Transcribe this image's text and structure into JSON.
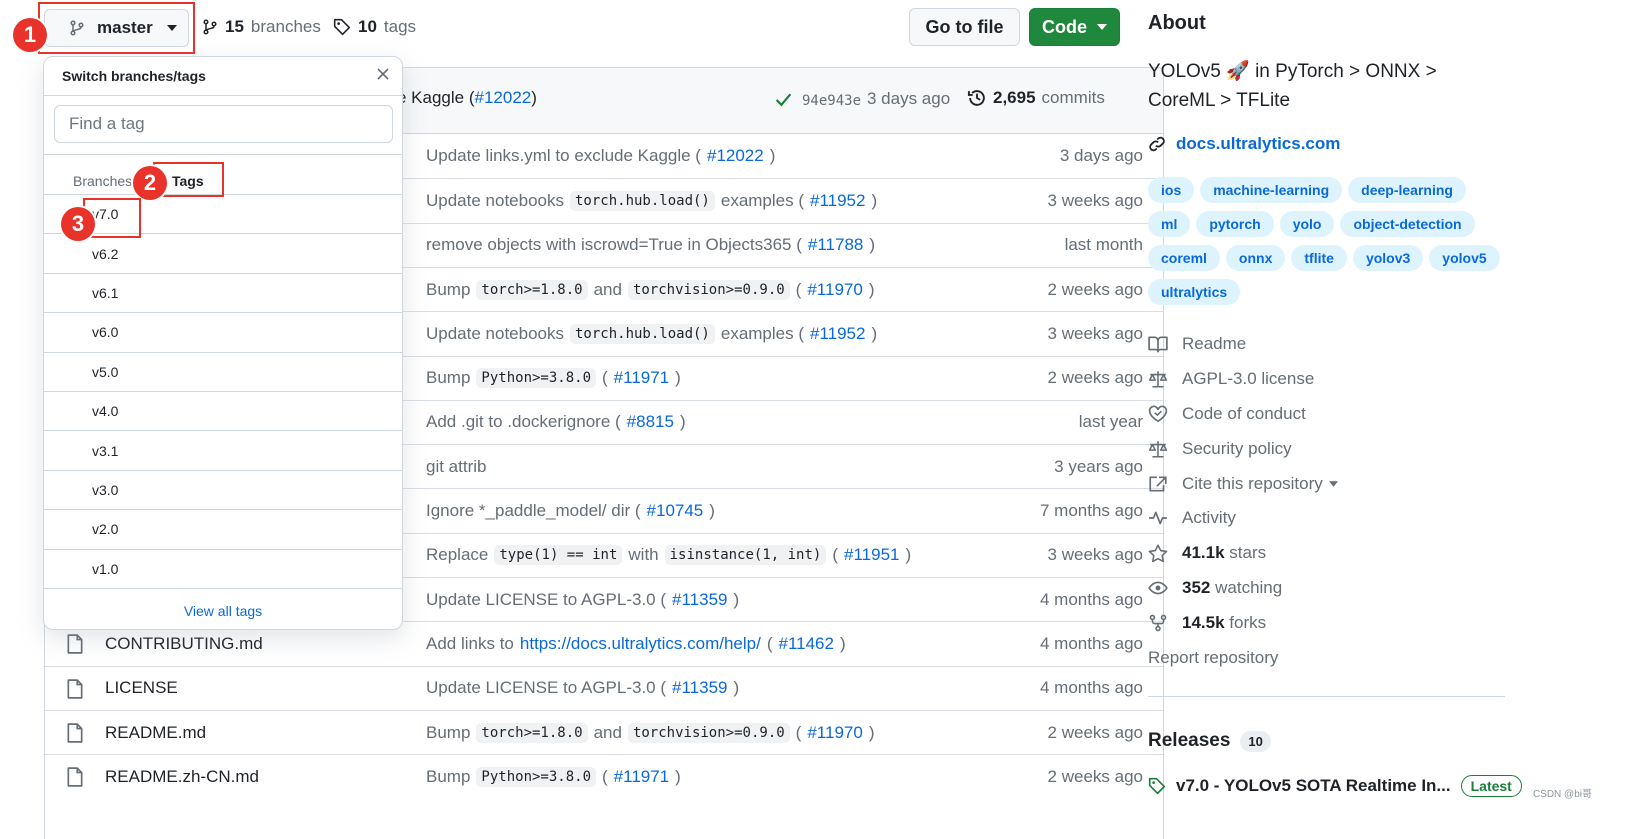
{
  "topbar": {
    "branch": "master",
    "branches_count": "15",
    "branches_label": "branches",
    "tags_count": "10",
    "tags_label": "tags",
    "go_to_file": "Go to file",
    "code": "Code"
  },
  "annotations": {
    "one": "1",
    "two": "2",
    "three": "3"
  },
  "commit_head": {
    "message_prefix": "e Kaggle (",
    "pr": "#12022",
    "message_suffix": ")",
    "sha": "94e943e",
    "time": "3 days ago",
    "commits_count": "2,695",
    "commits_label": "commits"
  },
  "rows": [
    {
      "name": "",
      "time": "3 days ago",
      "parts": [
        {
          "t": "Update links.yml to exclude Kaggle ("
        },
        {
          "l": "#12022"
        },
        {
          "t": ")"
        }
      ]
    },
    {
      "name": "",
      "time": "3 weeks ago",
      "parts": [
        {
          "t": "Update notebooks "
        },
        {
          "c": "torch.hub.load()"
        },
        {
          "t": " examples ("
        },
        {
          "l": "#11952"
        },
        {
          "t": ")"
        }
      ]
    },
    {
      "name": "",
      "time": "last month",
      "parts": [
        {
          "t": "remove objects with iscrowd=True in Objects365 ("
        },
        {
          "l": "#11788"
        },
        {
          "t": ")"
        }
      ]
    },
    {
      "name": "",
      "time": "2 weeks ago",
      "parts": [
        {
          "t": "Bump "
        },
        {
          "c": "torch>=1.8.0"
        },
        {
          "t": " and "
        },
        {
          "c": "torchvision>=0.9.0"
        },
        {
          "t": " ("
        },
        {
          "l": "#11970"
        },
        {
          "t": ")"
        }
      ]
    },
    {
      "name": "",
      "time": "3 weeks ago",
      "parts": [
        {
          "t": "Update notebooks "
        },
        {
          "c": "torch.hub.load()"
        },
        {
          "t": " examples ("
        },
        {
          "l": "#11952"
        },
        {
          "t": ")"
        }
      ]
    },
    {
      "name": "",
      "time": "2 weeks ago",
      "parts": [
        {
          "t": "Bump "
        },
        {
          "c": "Python>=3.8.0"
        },
        {
          "t": " ("
        },
        {
          "l": "#11971"
        },
        {
          "t": ")"
        }
      ]
    },
    {
      "name": "",
      "time": "last year",
      "parts": [
        {
          "t": "Add .git to .dockerignore ("
        },
        {
          "l": "#8815"
        },
        {
          "t": ")"
        }
      ]
    },
    {
      "name": "",
      "time": "3 years ago",
      "parts": [
        {
          "t": "git attrib"
        }
      ]
    },
    {
      "name": "",
      "time": "7 months ago",
      "parts": [
        {
          "t": "Ignore *_paddle_model/ dir ("
        },
        {
          "l": "#10745"
        },
        {
          "t": ")"
        }
      ]
    },
    {
      "name": "",
      "time": "3 weeks ago",
      "parts": [
        {
          "t": "Replace "
        },
        {
          "c": "type(1) == int"
        },
        {
          "t": " with "
        },
        {
          "c": "isinstance(1, int)"
        },
        {
          "t": " ("
        },
        {
          "l": "#11951"
        },
        {
          "t": ")"
        }
      ]
    },
    {
      "name": "",
      "time": "4 months ago",
      "parts": [
        {
          "t": "Update LICENSE to AGPL-3.0 ("
        },
        {
          "l": "#11359"
        },
        {
          "t": ")"
        }
      ]
    },
    {
      "name": "CONTRIBUTING.md",
      "time": "4 months ago",
      "parts": [
        {
          "t": "Add links to "
        },
        {
          "l": "https://docs.ultralytics.com/help/"
        },
        {
          "t": " ("
        },
        {
          "l": "#11462"
        },
        {
          "t": ")"
        }
      ]
    },
    {
      "name": "LICENSE",
      "time": "4 months ago",
      "parts": [
        {
          "t": "Update LICENSE to AGPL-3.0 ("
        },
        {
          "l": "#11359"
        },
        {
          "t": ")"
        }
      ]
    },
    {
      "name": "README.md",
      "time": "2 weeks ago",
      "parts": [
        {
          "t": "Bump "
        },
        {
          "c": "torch>=1.8.0"
        },
        {
          "t": " and "
        },
        {
          "c": "torchvision>=0.9.0"
        },
        {
          "t": " ("
        },
        {
          "l": "#11970"
        },
        {
          "t": ")"
        }
      ]
    },
    {
      "name": "README.zh-CN.md",
      "time": "2 weeks ago",
      "parts": [
        {
          "t": "Bump "
        },
        {
          "c": "Python>=3.8.0"
        },
        {
          "t": " ("
        },
        {
          "l": "#11971"
        },
        {
          "t": ")"
        }
      ]
    }
  ],
  "dropdown": {
    "title": "Switch branches/tags",
    "placeholder": "Find a tag",
    "tab_branches": "Branches",
    "tab_tags": "Tags",
    "tags": [
      "v7.0",
      "v6.2",
      "v6.1",
      "v6.0",
      "v5.0",
      "v4.0",
      "v3.1",
      "v3.0",
      "v2.0",
      "v1.0"
    ],
    "view_all": "View all tags"
  },
  "about": {
    "title": "About",
    "description": "YOLOv5 🚀 in PyTorch > ONNX > CoreML > TFLite",
    "homepage": "docs.ultralytics.com",
    "topics": [
      "ios",
      "machine-learning",
      "deep-learning",
      "ml",
      "pytorch",
      "yolo",
      "object-detection",
      "coreml",
      "onnx",
      "tflite",
      "yolov3",
      "yolov5",
      "ultralytics"
    ],
    "readme": "Readme",
    "license": "AGPL-3.0 license",
    "conduct": "Code of conduct",
    "security": "Security policy",
    "cite": "Cite this repository",
    "activity": "Activity",
    "stars_count": "41.1k",
    "stars_label": "stars",
    "watching_count": "352",
    "watching_label": "watching",
    "forks_count": "14.5k",
    "forks_label": "forks",
    "report": "Report repository"
  },
  "releases": {
    "title": "Releases",
    "count": "10",
    "latest_name": "v7.0 - YOLOv5 SOTA Realtime In...",
    "latest_badge": "Latest"
  },
  "watermark": "CSDN @bi哥",
  "colors": {
    "accent": "#0969da",
    "green": "#1f883d",
    "annotation_red": "#e8322a"
  }
}
